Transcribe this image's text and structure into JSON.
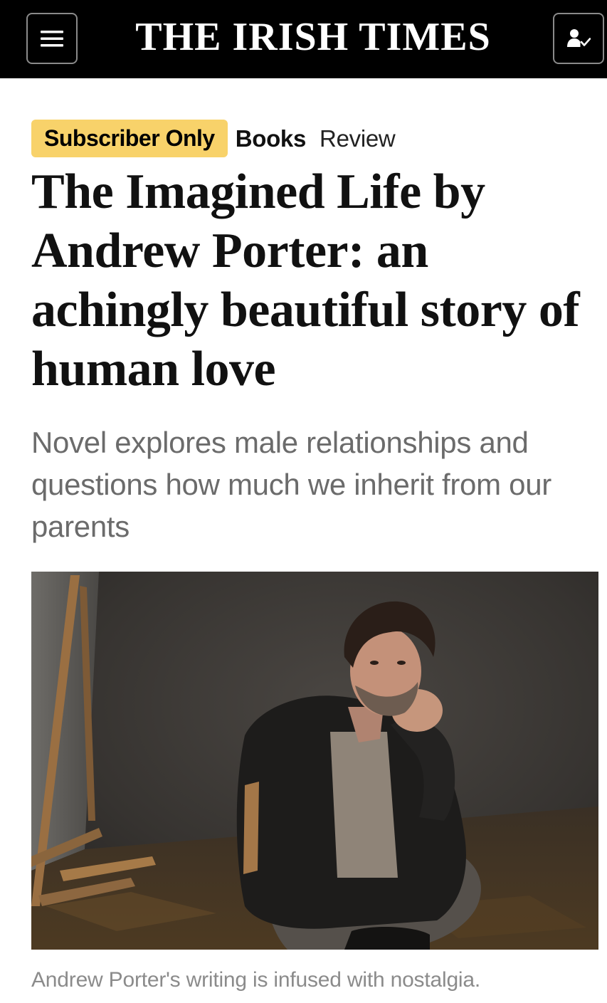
{
  "header": {
    "logo_text": "THE IRISH TIMES",
    "menu_icon": "hamburger-menu-icon",
    "account_icon": "user-check-icon",
    "background_color": "#000000"
  },
  "tags": {
    "badge": "Subscriber Only",
    "badge_color": "#f8d26a",
    "section": "Books",
    "type": "Review"
  },
  "article": {
    "headline": "The Imagined Life by Andrew Porter: an achingly beautiful story of human love",
    "standfirst": "Novel explores male relationships and questions how much we inherit from our parents",
    "image_alt": "Andrew Porter",
    "caption": "Andrew Porter's writing is infused with nostalgia."
  }
}
